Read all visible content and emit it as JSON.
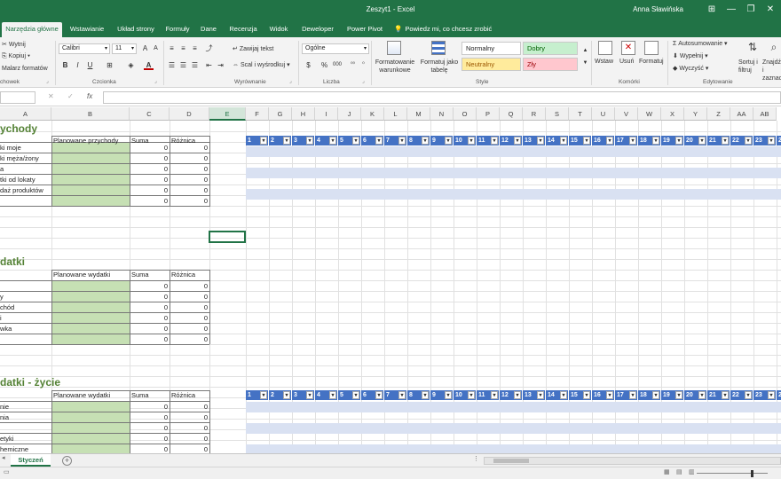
{
  "window": {
    "title": "Zeszyt1  -  Excel",
    "user": "Anna Sławińska",
    "controls": [
      "⊞",
      "—",
      "❐",
      "✕"
    ]
  },
  "ribbon_tabs": [
    {
      "label": "Narzędzia główne",
      "active": true
    },
    {
      "label": "Wstawianie"
    },
    {
      "label": "Układ strony"
    },
    {
      "label": "Formuły"
    },
    {
      "label": "Dane"
    },
    {
      "label": "Recenzja"
    },
    {
      "label": "Widok"
    },
    {
      "label": "Deweloper"
    },
    {
      "label": "Power Pivot"
    },
    {
      "label": "Powiedz mi, co chcesz zrobić"
    }
  ],
  "ribbon": {
    "clipboard": {
      "cut": "Wytnij",
      "copy": "Kopiuj",
      "painter": "Malarz formatów",
      "group": "chowek"
    },
    "font": {
      "name": "Calibri",
      "size": "11",
      "group": "Czcionka"
    },
    "alignment": {
      "wrap": "Zawijaj tekst",
      "merge": "Scal i wyśrodkuj",
      "group": "Wyrównanie"
    },
    "number": {
      "format": "Ogólne",
      "percent": "%",
      "thousands": "000",
      "group": "Liczba"
    },
    "styles": {
      "conditional": "Formatowanie warunkowe",
      "as_table": "Formatuj jako tabelę",
      "normal": "Normalny",
      "good": "Dobry",
      "neutral": "Neutralny",
      "bad": "Zły",
      "group": "Style"
    },
    "cells": {
      "insert": "Wstaw",
      "delete": "Usuń",
      "format": "Formatuj",
      "group": "Komórki"
    },
    "editing": {
      "autosum": "Autosumowanie",
      "fill": "Wypełnij",
      "clear": "Wyczyść",
      "sort": "Sortuj i filtruj",
      "find": "Znajdź i zaznacz",
      "group": "Edytowanie"
    }
  },
  "formula_bar": {
    "name_box": "",
    "fx": "fx",
    "value": ""
  },
  "columns": [
    "A",
    "B",
    "C",
    "D",
    "E",
    "F",
    "G",
    "H",
    "I",
    "J",
    "K",
    "L",
    "M",
    "N",
    "O",
    "P",
    "Q",
    "R",
    "S",
    "T",
    "U",
    "V",
    "W",
    "X",
    "Y",
    "Z",
    "AA",
    "AB"
  ],
  "selected_column": "E",
  "income": {
    "heading": "ychody",
    "headers": [
      "Planowane przychody",
      "Suma",
      "Różnica"
    ],
    "rows": [
      {
        "label": "ki moje",
        "sum": "0",
        "diff": "0"
      },
      {
        "label": "ki męża/żony",
        "sum": "0",
        "diff": "0"
      },
      {
        "label": "a",
        "sum": "0",
        "diff": "0"
      },
      {
        "label": "tki od lokaty",
        "sum": "0",
        "diff": "0"
      },
      {
        "label": "daż produktów",
        "sum": "0",
        "diff": "0"
      },
      {
        "label": "",
        "sum": "0",
        "diff": "0"
      }
    ]
  },
  "expenses": {
    "heading": "datki",
    "headers": [
      "Planowane wydatki",
      "Suma",
      "Różnica"
    ],
    "rows": [
      {
        "label": "",
        "sum": "0",
        "diff": "0"
      },
      {
        "label": "y",
        "sum": "0",
        "diff": "0"
      },
      {
        "label": "chód",
        "sum": "0",
        "diff": "0"
      },
      {
        "label": "i",
        "sum": "0",
        "diff": "0"
      },
      {
        "label": "wka",
        "sum": "0",
        "diff": "0"
      },
      {
        "label": "",
        "sum": "0",
        "diff": "0"
      }
    ]
  },
  "living": {
    "heading": "datki - życie",
    "headers": [
      "Planowane wydatki",
      "Suma",
      "Różnica"
    ],
    "rows": [
      {
        "label": "nie",
        "sum": "0",
        "diff": "0"
      },
      {
        "label": "nia",
        "sum": "0",
        "diff": "0"
      },
      {
        "label": "",
        "sum": "0",
        "diff": "0"
      },
      {
        "label": "etyki",
        "sum": "0",
        "diff": "0"
      },
      {
        "label": "hemiczne",
        "sum": "0",
        "diff": "0"
      }
    ]
  },
  "day_headers": [
    "1",
    "2",
    "3",
    "4",
    "5",
    "6",
    "7",
    "8",
    "9",
    "10",
    "11",
    "12",
    "13",
    "14",
    "15",
    "16",
    "17",
    "18",
    "19",
    "20",
    "21",
    "22",
    "23",
    "2"
  ],
  "sheet": {
    "tab": "Styczeń",
    "add": "+"
  },
  "colors": {
    "excel_green": "#217346",
    "heading_green": "#548235",
    "input_green": "#c6e0b4",
    "blue_header": "#4472c4",
    "blue_band": "#d9e1f2"
  }
}
